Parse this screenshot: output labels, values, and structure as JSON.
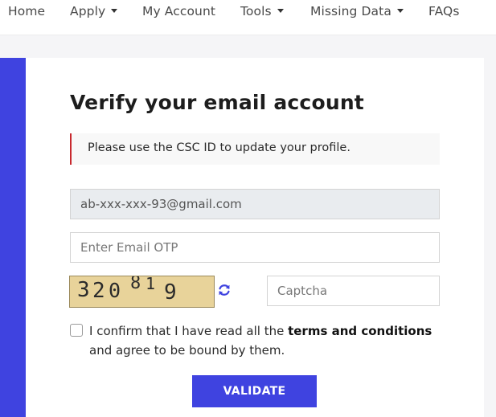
{
  "nav": {
    "items": [
      {
        "label": "Home",
        "dropdown": false
      },
      {
        "label": "Apply",
        "dropdown": true
      },
      {
        "label": "My Account",
        "dropdown": false
      },
      {
        "label": "Tools",
        "dropdown": true
      },
      {
        "label": "Missing Data",
        "dropdown": true
      },
      {
        "label": "FAQs",
        "dropdown": false
      }
    ]
  },
  "form": {
    "title": "Verify your email account",
    "alert": "Please use the CSC ID to update your profile.",
    "email_value": "ab-xxx-xxx-93@gmail.com",
    "otp_placeholder": "Enter Email OTP",
    "captcha_text": "320819",
    "captcha_placeholder": "Captcha",
    "consent_prefix": "I confirm that I have read all the ",
    "consent_link": "terms and conditions",
    "consent_suffix": "and agree to be bound by them.",
    "validate_label": "VALIDATE"
  },
  "icons": {
    "refresh": "refresh-icon",
    "dropdown": "chevron-down-icon"
  },
  "colors": {
    "accent": "#3f43e0",
    "alert_border": "#c8282e",
    "captcha_bg": "#e8d39a"
  }
}
